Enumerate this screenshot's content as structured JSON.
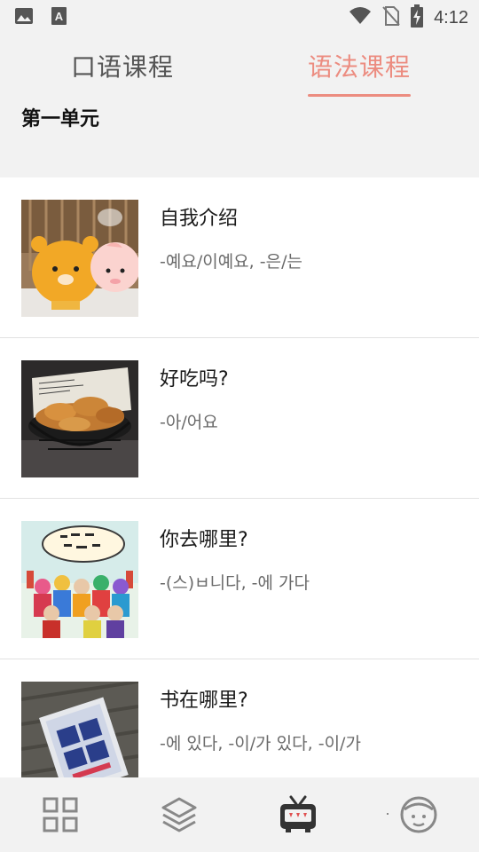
{
  "status_bar": {
    "time": "4:12",
    "left_icons": [
      "image-icon",
      "font-a-icon"
    ],
    "right_icons": [
      "wifi-icon",
      "no-sim-icon",
      "battery-charging-icon"
    ]
  },
  "tabs": [
    {
      "label": "口语课程",
      "active": false
    },
    {
      "label": "语法课程",
      "active": true
    }
  ],
  "accent_color": "#ec8c80",
  "unit": {
    "title": "第一单元"
  },
  "lessons": [
    {
      "title": "自我介绍",
      "grammar": "-예요/이예요, -은/는",
      "thumbnail": "kakao-figures-photo"
    },
    {
      "title": "好吃吗?",
      "grammar": "-아/어요",
      "thumbnail": "fried-chicken-photo"
    },
    {
      "title": "你去哪里?",
      "grammar": "-(스)ㅂ니다, -에 가다",
      "thumbnail": "family-show-poster"
    },
    {
      "title": "书在哪里?",
      "grammar": "-에 있다, -이/가 있다, -이/가",
      "thumbnail": "book-on-bench-photo"
    }
  ],
  "bottom_nav": [
    {
      "icon": "grid-icon"
    },
    {
      "icon": "layers-icon"
    },
    {
      "icon": "tv-icon",
      "active": true
    },
    {
      "icon": "profile-face-icon"
    }
  ]
}
